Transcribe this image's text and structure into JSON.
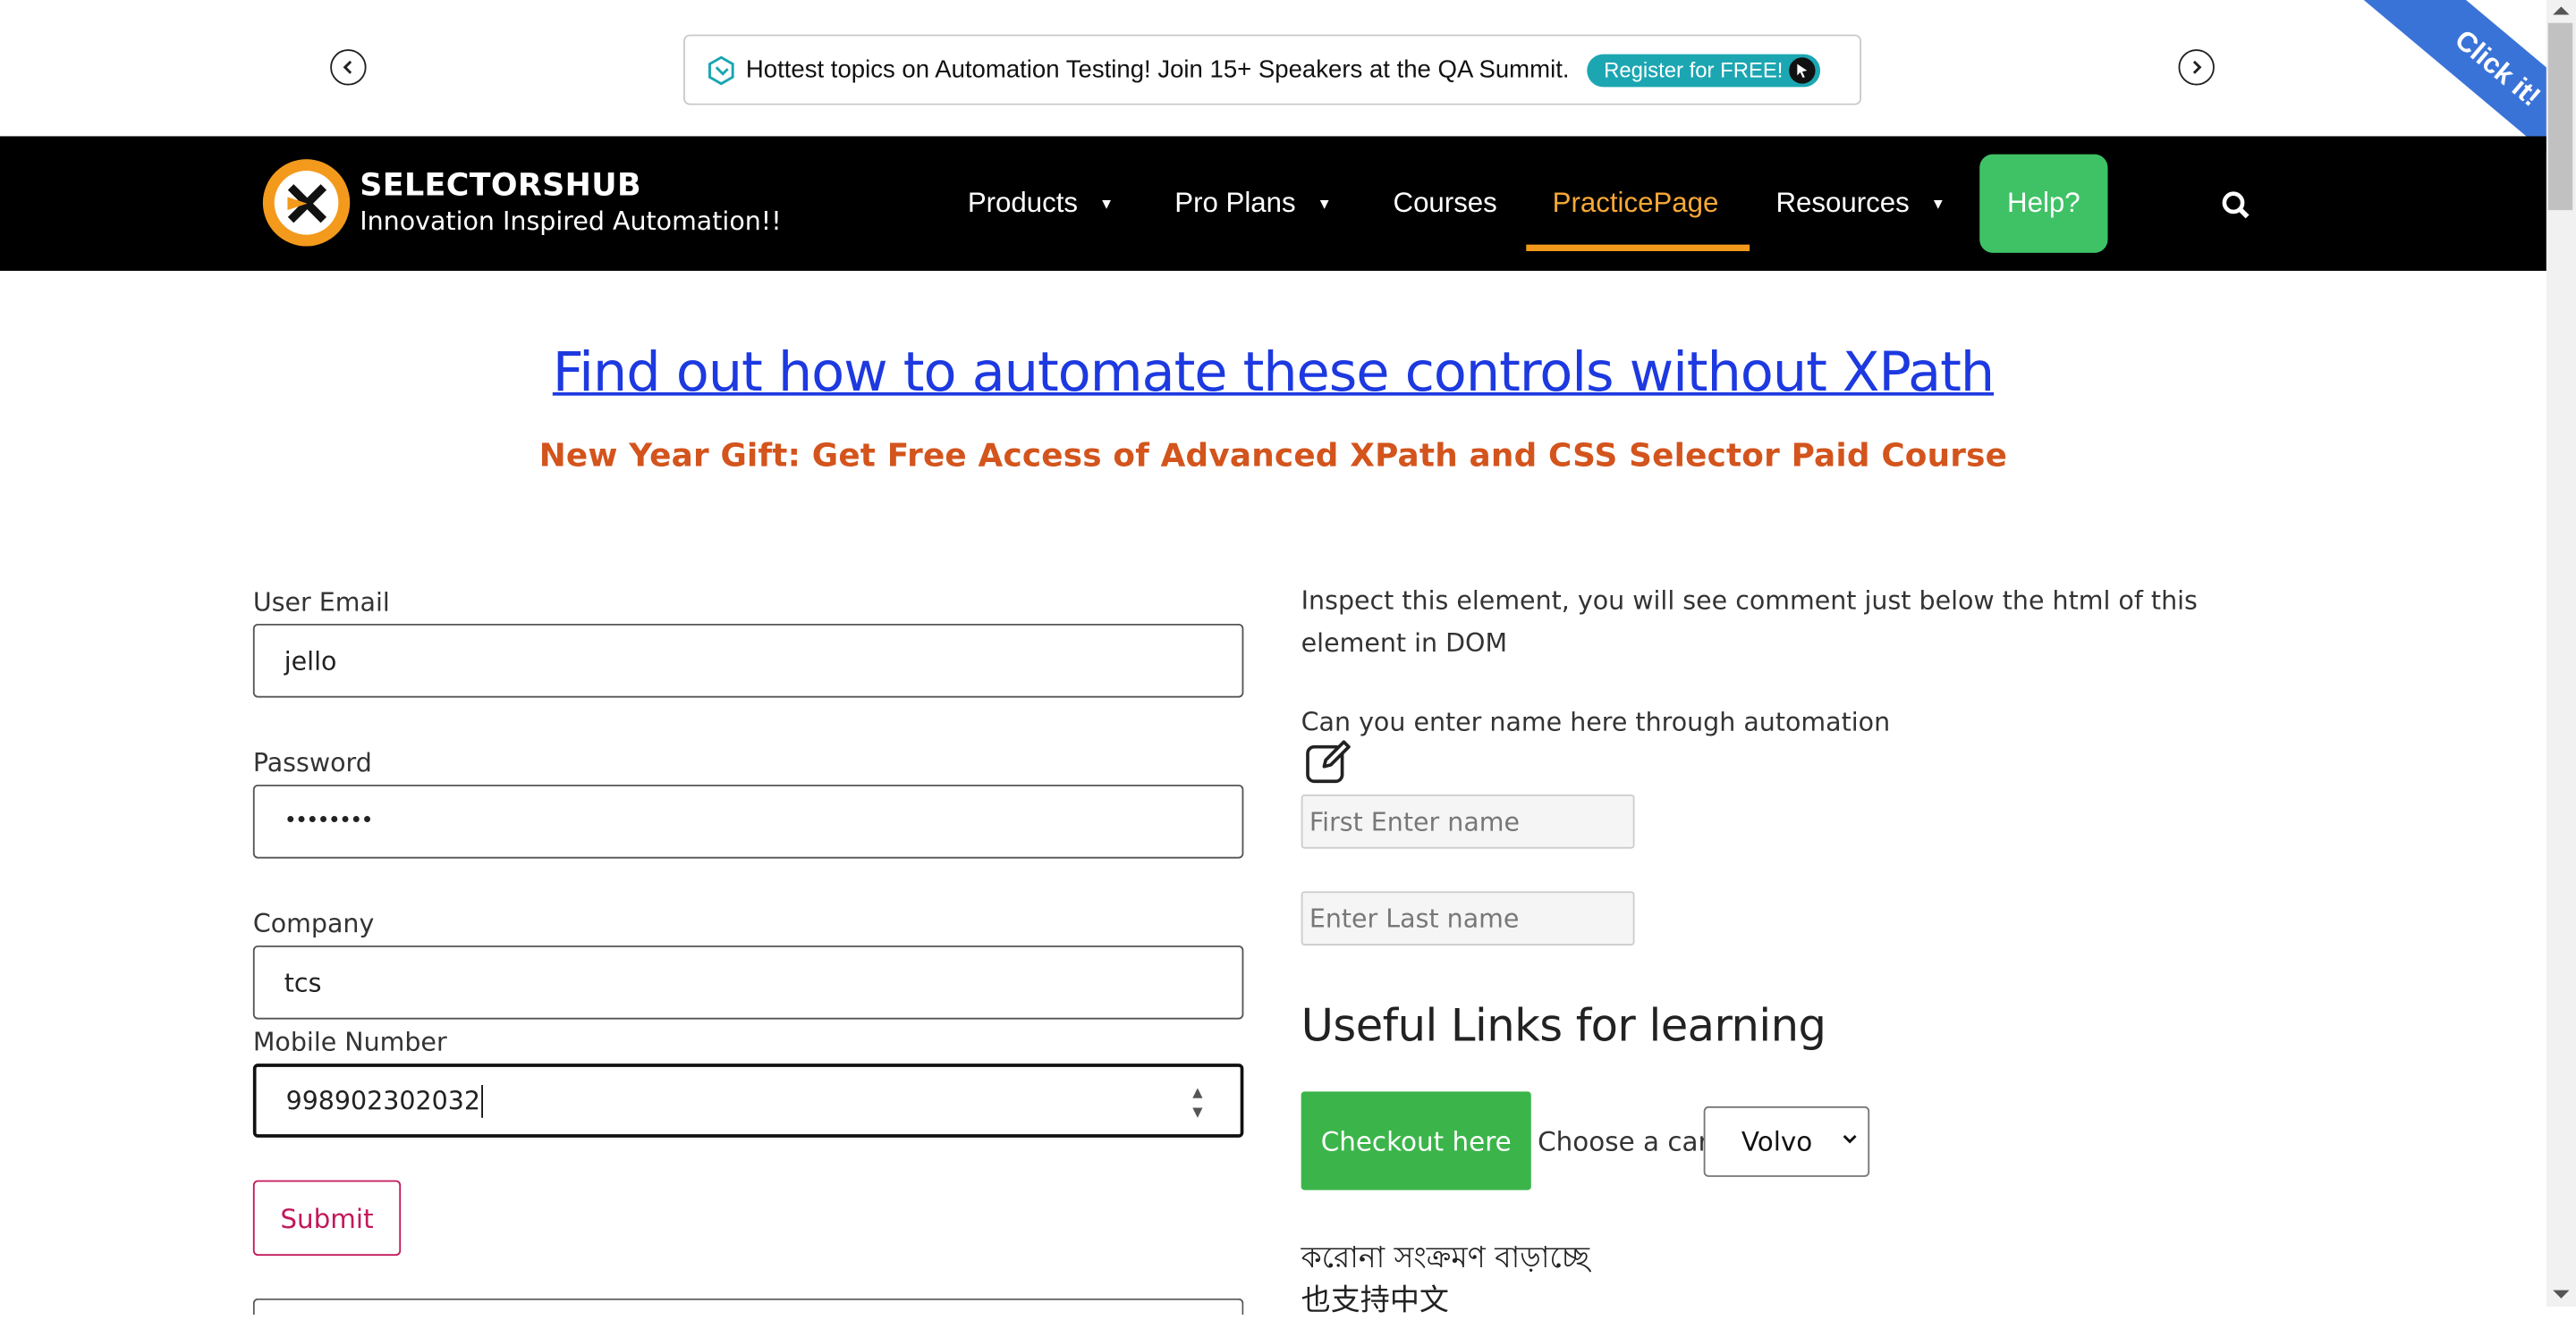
{
  "promo": {
    "text": "Hottest topics on Automation Testing! Join 15+ Speakers at the QA Summit.",
    "cta": "Register for FREE!",
    "ribbon": "Click it!"
  },
  "nav": {
    "brand_name": "SELECTORSHUB",
    "brand_tagline": "Innovation Inspired Automation!!",
    "items": [
      {
        "label": "Products"
      },
      {
        "label": "Pro Plans"
      },
      {
        "label": "Courses"
      },
      {
        "label": "PracticePage"
      },
      {
        "label": "Resources"
      }
    ],
    "help": "Help?"
  },
  "headline": "Find out how to automate these controls without XPath",
  "subheadline": "New Year Gift: Get Free Access of Advanced XPath and CSS Selector Paid Course",
  "form": {
    "email_label": "User Email",
    "email_value": "jello",
    "password_label": "Password",
    "password_value": "••••••••",
    "company_label": "Company",
    "company_value": "tcs",
    "mobile_label": "Mobile Number",
    "mobile_value": "998902302032",
    "submit": "Submit"
  },
  "right": {
    "inspect_text": "Inspect this element, you will see comment just below the html of this element in DOM",
    "automation_text": "Can you enter name here through automation",
    "first_name_placeholder": "First Enter name",
    "last_name_placeholder": "Enter Last name",
    "useful_links": "Useful Links for learning",
    "checkout": "Checkout here",
    "car_label": "Choose a car:",
    "car_selected": "Volvo",
    "bengali_text": "করোনা সংক্রমণ বাড়াচ্ছে",
    "chinese_text": "也支持中文"
  },
  "colors": {
    "nav_bg": "#000000",
    "accent_orange": "#f39a1c",
    "help_green": "#3fc266",
    "link_blue": "#1d39e0",
    "subhead_orange": "#d3541c",
    "checkout_green": "#3bb54a",
    "submit_pink": "#c2185b"
  }
}
